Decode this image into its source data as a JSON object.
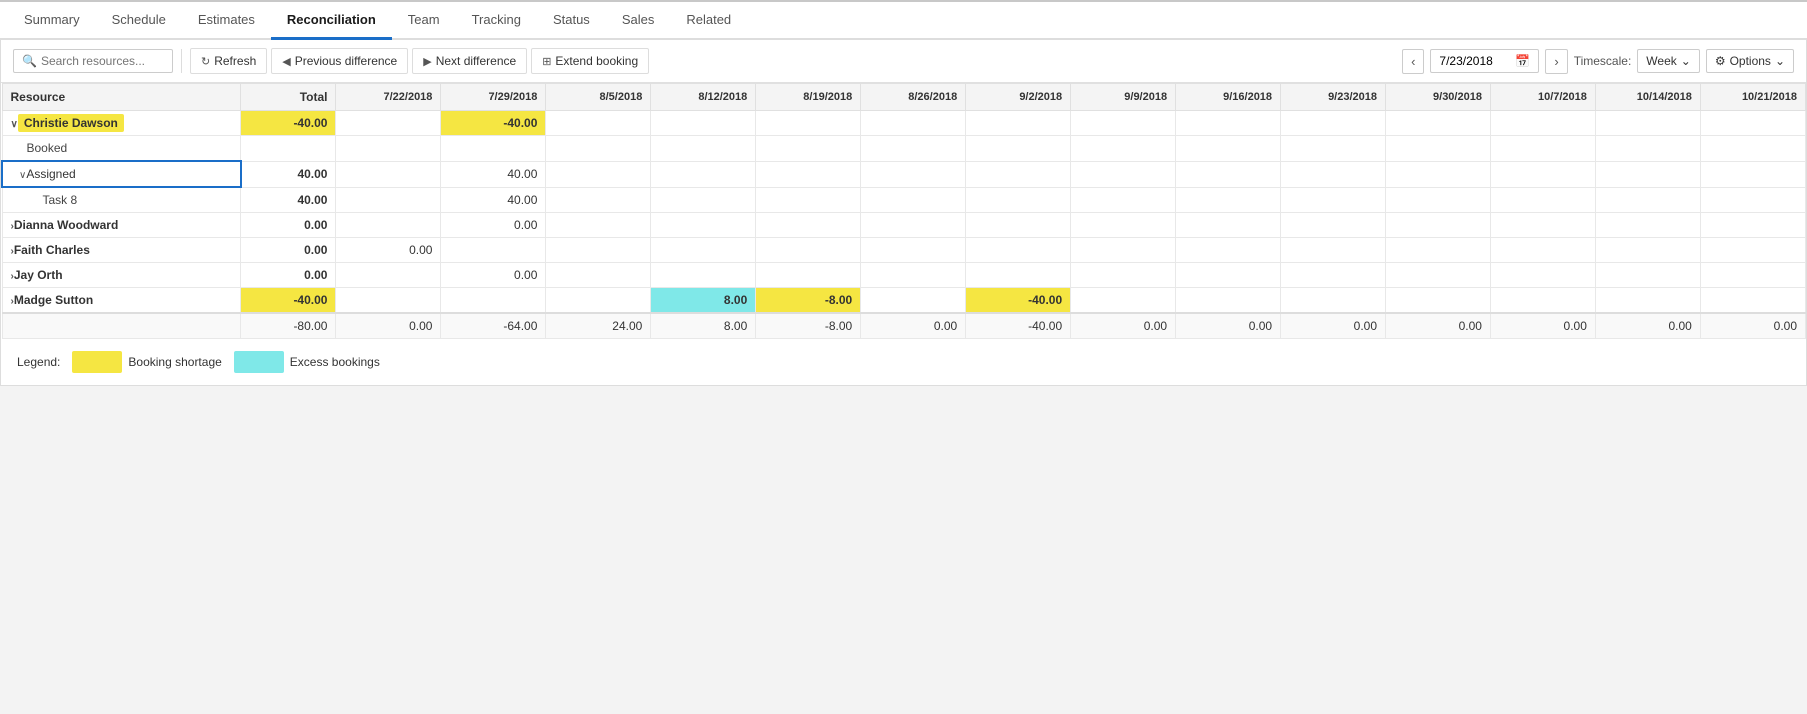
{
  "nav": {
    "tabs": [
      {
        "id": "summary",
        "label": "Summary",
        "active": false
      },
      {
        "id": "schedule",
        "label": "Schedule",
        "active": false
      },
      {
        "id": "estimates",
        "label": "Estimates",
        "active": false
      },
      {
        "id": "reconciliation",
        "label": "Reconciliation",
        "active": true
      },
      {
        "id": "team",
        "label": "Team",
        "active": false
      },
      {
        "id": "tracking",
        "label": "Tracking",
        "active": false
      },
      {
        "id": "status",
        "label": "Status",
        "active": false
      },
      {
        "id": "sales",
        "label": "Sales",
        "active": false
      },
      {
        "id": "related",
        "label": "Related",
        "active": false
      }
    ]
  },
  "toolbar": {
    "search_placeholder": "Search resources...",
    "refresh_label": "Refresh",
    "prev_diff_label": "Previous difference",
    "next_diff_label": "Next difference",
    "extend_booking_label": "Extend booking",
    "current_date": "7/23/2018",
    "timescale_label": "Timescale:",
    "timescale_value": "Week",
    "options_label": "Options"
  },
  "grid": {
    "headers": {
      "resource": "Resource",
      "total": "Total",
      "dates": [
        "7/22/2018",
        "7/29/2018",
        "8/5/2018",
        "8/12/2018",
        "8/19/2018",
        "8/26/2018",
        "9/2/2018",
        "9/9/2018",
        "9/16/2018",
        "9/23/2018",
        "9/30/2018",
        "10/7/2018",
        "10/14/2018",
        "10/21/2018"
      ]
    },
    "rows": [
      {
        "type": "resource_main",
        "name": "Christie Dawson",
        "highlight": true,
        "expanded": true,
        "total": "-40.00",
        "total_style": "shortage",
        "values": [
          null,
          "-40.00",
          null,
          null,
          null,
          null,
          null,
          null,
          null,
          null,
          null,
          null,
          null,
          null
        ],
        "value_styles": [
          null,
          "shortage",
          null,
          null,
          null,
          null,
          null,
          null,
          null,
          null,
          null,
          null,
          null,
          null
        ]
      },
      {
        "type": "sub",
        "name": "Booked",
        "total": "",
        "values": [
          null,
          null,
          null,
          null,
          null,
          null,
          null,
          null,
          null,
          null,
          null,
          null,
          null,
          null
        ],
        "value_styles": [
          null,
          null,
          null,
          null,
          null,
          null,
          null,
          null,
          null,
          null,
          null,
          null,
          null,
          null
        ]
      },
      {
        "type": "assigned",
        "name": "Assigned",
        "expanded": true,
        "total": "40.00",
        "values": [
          null,
          "40.00",
          null,
          null,
          null,
          null,
          null,
          null,
          null,
          null,
          null,
          null,
          null,
          null
        ],
        "value_styles": [
          null,
          null,
          null,
          null,
          null,
          null,
          null,
          null,
          null,
          null,
          null,
          null,
          null,
          null
        ]
      },
      {
        "type": "task",
        "name": "Task 8",
        "total": "40.00",
        "values": [
          null,
          "40.00",
          null,
          null,
          null,
          null,
          null,
          null,
          null,
          null,
          null,
          null,
          null,
          null
        ],
        "value_styles": [
          null,
          null,
          null,
          null,
          null,
          null,
          null,
          null,
          null,
          null,
          null,
          null,
          null,
          null
        ]
      },
      {
        "type": "resource_main",
        "name": "Dianna Woodward",
        "highlight": false,
        "expanded": false,
        "total": "0.00",
        "total_style": null,
        "values": [
          null,
          "0.00",
          null,
          null,
          null,
          null,
          null,
          null,
          null,
          null,
          null,
          null,
          null,
          null
        ],
        "value_styles": [
          null,
          null,
          null,
          null,
          null,
          null,
          null,
          null,
          null,
          null,
          null,
          null,
          null,
          null
        ]
      },
      {
        "type": "resource_main",
        "name": "Faith Charles",
        "highlight": false,
        "expanded": false,
        "total": "0.00",
        "total_style": null,
        "values": [
          "0.00",
          null,
          null,
          null,
          null,
          null,
          null,
          null,
          null,
          null,
          null,
          null,
          null,
          null
        ],
        "value_styles": [
          null,
          null,
          null,
          null,
          null,
          null,
          null,
          null,
          null,
          null,
          null,
          null,
          null,
          null
        ]
      },
      {
        "type": "resource_main",
        "name": "Jay Orth",
        "highlight": false,
        "expanded": false,
        "total": "0.00",
        "total_style": null,
        "values": [
          null,
          "0.00",
          null,
          null,
          null,
          null,
          null,
          null,
          null,
          null,
          null,
          null,
          null,
          null
        ],
        "value_styles": [
          null,
          null,
          null,
          null,
          null,
          null,
          null,
          null,
          null,
          null,
          null,
          null,
          null,
          null
        ]
      },
      {
        "type": "resource_main",
        "name": "Madge Sutton",
        "highlight": false,
        "expanded": false,
        "total": "-40.00",
        "total_style": "shortage",
        "values": [
          null,
          null,
          null,
          "8.00",
          "-8.00",
          null,
          "-40.00",
          null,
          null,
          null,
          null,
          null,
          null,
          null
        ],
        "value_styles": [
          null,
          null,
          null,
          "excess",
          "shortage",
          null,
          "shortage",
          null,
          null,
          null,
          null,
          null,
          null,
          null
        ]
      }
    ],
    "footer": {
      "values": [
        "-80.00",
        "0.00",
        "-64.00",
        "24.00",
        "8.00",
        "-8.00",
        "0.00",
        "-40.00",
        "0.00",
        "0.00",
        "0.00",
        "0.00",
        "0.00",
        "0.00",
        "0.00"
      ]
    }
  },
  "legend": {
    "label": "Legend:",
    "items": [
      {
        "id": "shortage",
        "label": "Booking shortage",
        "style": "shortage"
      },
      {
        "id": "excess",
        "label": "Excess bookings",
        "style": "excess"
      }
    ]
  }
}
